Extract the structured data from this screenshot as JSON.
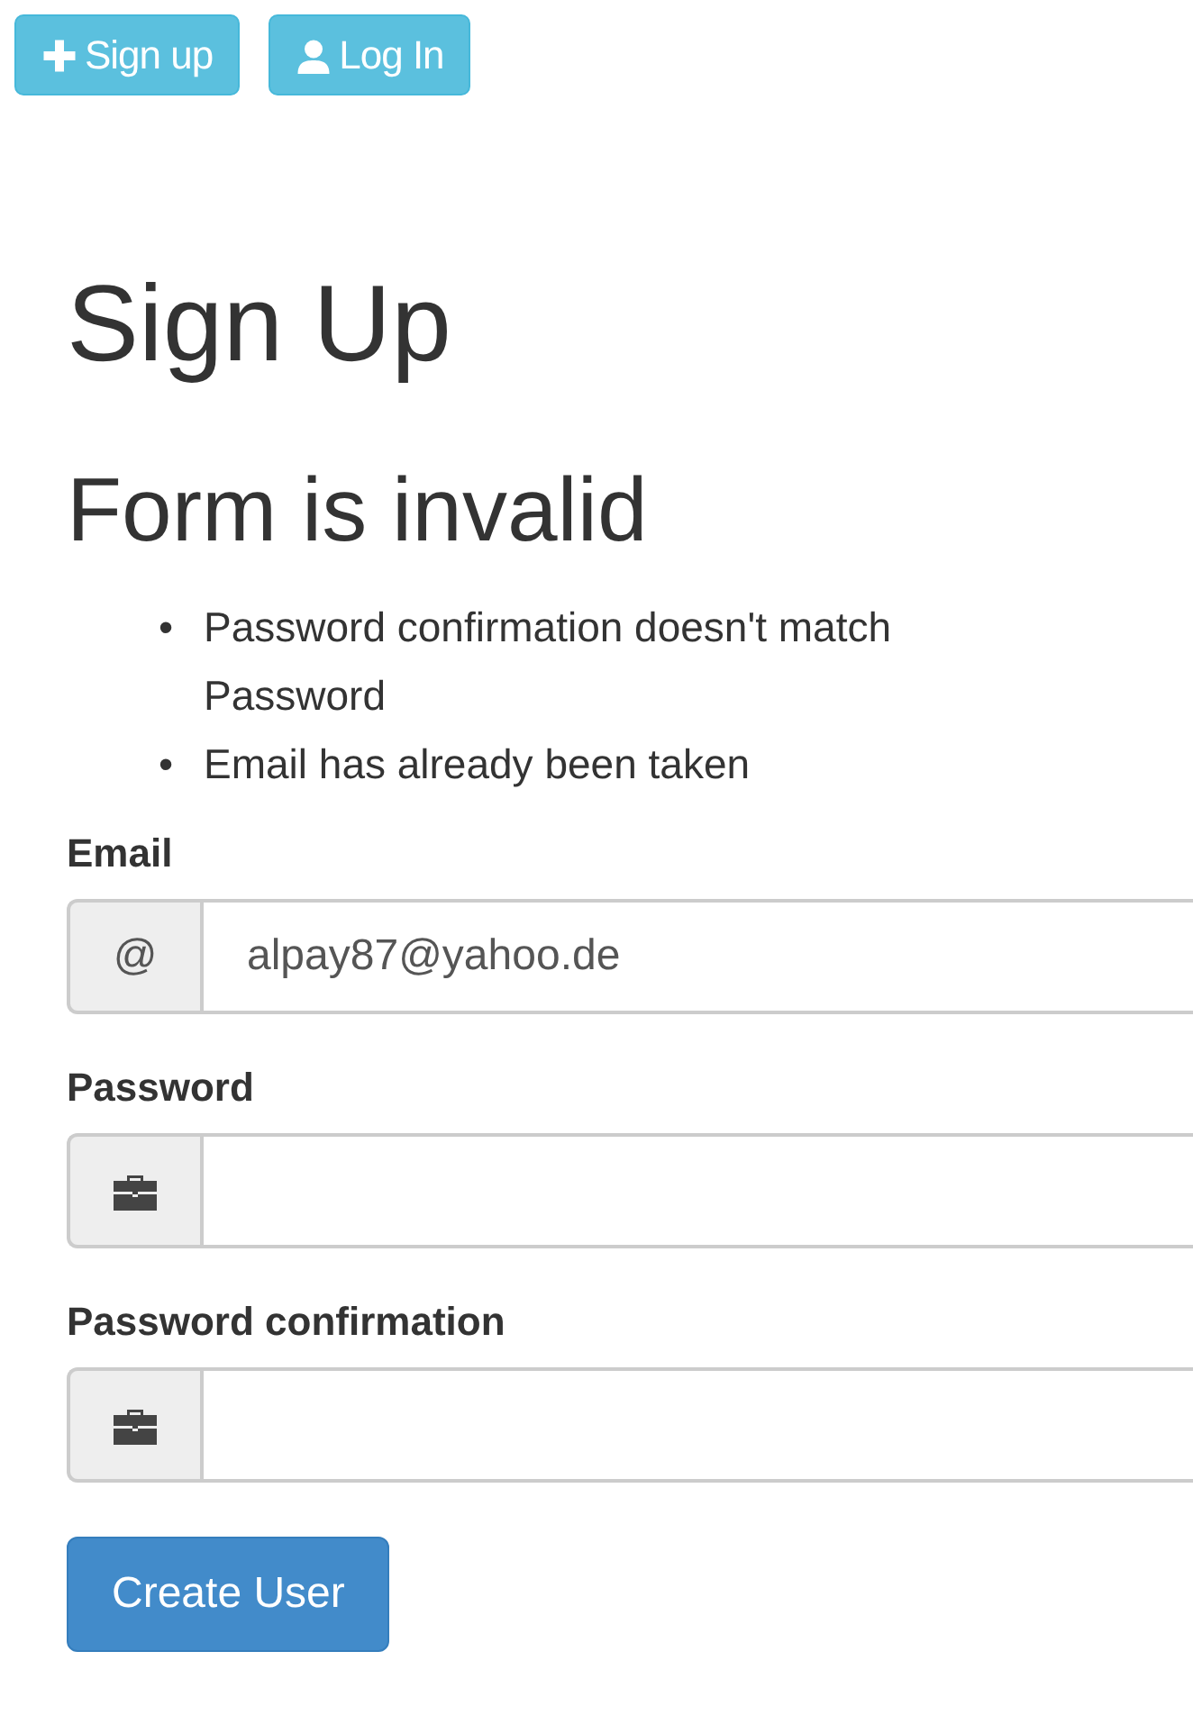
{
  "nav_buttons": [
    {
      "kind": "plus",
      "label": "Sign up"
    },
    {
      "kind": "user",
      "label": "Log In"
    }
  ],
  "title": "Sign Up",
  "error_heading": "Form is invalid",
  "errors": [
    {
      "bullet": "•",
      "text": "Password confirmation doesn't match Password"
    },
    {
      "bullet": "•",
      "text": "Email has already been taken"
    }
  ],
  "fields": [
    {
      "label": "Email",
      "addon": {
        "kind": "text",
        "text": "@"
      },
      "value": "alpay87@yahoo.de"
    },
    {
      "label": "Password",
      "addon": {
        "kind": "briefcase"
      }
    },
    {
      "label": "Password confirmation",
      "addon": {
        "kind": "briefcase"
      }
    }
  ],
  "submit": "Create User"
}
